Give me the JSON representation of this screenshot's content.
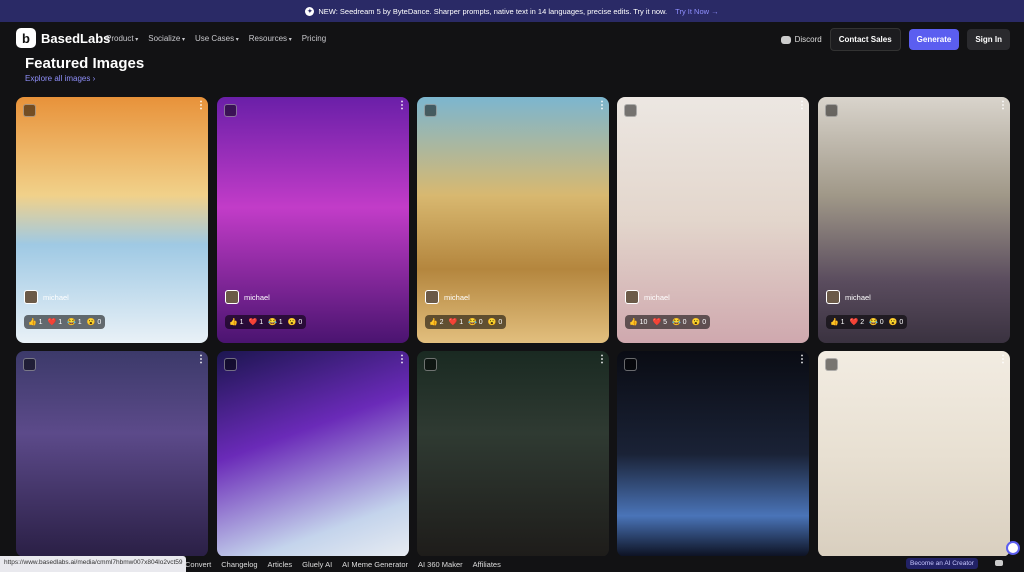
{
  "announcement": {
    "text": "NEW: Seedream 5 by ByteDance. Sharper prompts, native text in 14 languages, precise edits. Try it now.",
    "cta": "Try It Now →"
  },
  "brand": {
    "name": "BasedLabs"
  },
  "nav": {
    "links": [
      "Product",
      "Socialize",
      "Use Cases",
      "Resources",
      "Pricing"
    ],
    "discord": "Discord",
    "contact": "Contact Sales",
    "generate": "Generate",
    "signin": "Sign In"
  },
  "featured": {
    "title": "Featured Images",
    "explore": "Explore all images ›",
    "cards": [
      {
        "user": "michael",
        "reactions": [
          "👍 1",
          "❤️ 1",
          "😂 1",
          "😮 0"
        ]
      },
      {
        "user": "michael",
        "reactions": [
          "👍 1",
          "❤️ 1",
          "😂 1",
          "😮 0"
        ]
      },
      {
        "user": "michael",
        "reactions": [
          "👍 2",
          "❤️ 1",
          "😂 0",
          "😮 0"
        ]
      },
      {
        "user": "michael",
        "reactions": [
          "👍 10",
          "❤️ 5",
          "😂 0",
          "😮 0"
        ]
      },
      {
        "user": "michael",
        "reactions": [
          "👍 1",
          "❤️ 2",
          "😂 0",
          "😮 0"
        ]
      }
    ]
  },
  "footer": {
    "url": "https://www.basedlabs.ai/media/cmml7hbmw007x804lo2vct59",
    "links": [
      "Convert",
      "Changelog",
      "Articles",
      "Gluely AI",
      "AI Meme Generator",
      "AI 360 Maker",
      "Affiliates"
    ],
    "creator": "Become an AI Creator"
  }
}
